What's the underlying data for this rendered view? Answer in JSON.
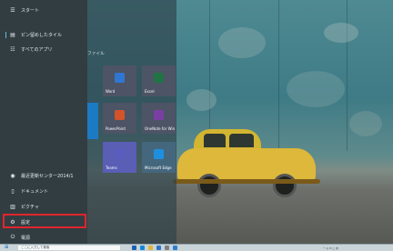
{
  "start_menu": {
    "nav": [
      {
        "icon": "hamburger-icon",
        "glyph": "☰",
        "label": "スタート"
      },
      {
        "icon": "pin-icon",
        "glyph": "▤",
        "label": "ピン留めしたタイル"
      },
      {
        "icon": "list-icon",
        "glyph": "☷",
        "label": "すべてのアプリ"
      }
    ],
    "bottom_nav": [
      {
        "icon": "security-icon",
        "glyph": "◉",
        "label": "最近更新センター2014/1"
      },
      {
        "icon": "document-icon",
        "glyph": "▯",
        "label": "ドキュメント"
      },
      {
        "icon": "picture-icon",
        "glyph": "▥",
        "label": "ピクチャ"
      },
      {
        "icon": "gear-icon",
        "glyph": "⚙",
        "label": "設定"
      },
      {
        "icon": "power-icon",
        "glyph": "⏻",
        "label": "電源"
      }
    ],
    "section_title": "ファイル",
    "tiles": [
      {
        "name": "Word",
        "color": "#2f77d3"
      },
      {
        "name": "Excel",
        "color": "#217346"
      },
      {
        "name": "PowerPoint",
        "color": "#d35428"
      },
      {
        "name": "OneNote for Windows",
        "color": "#7b3fa4"
      },
      {
        "name": "Teams",
        "color": "#5a5dbd"
      },
      {
        "name": "Microsoft Edge",
        "color": "#1e8fe0"
      }
    ]
  },
  "taskbar": {
    "search_placeholder": "ここに入力して検索",
    "apps": [
      {
        "icon": "task-view-icon",
        "color": "#1b5fb2"
      },
      {
        "icon": "edge-icon",
        "color": "#1587d6"
      },
      {
        "icon": "folder-icon",
        "color": "#e0b43d"
      },
      {
        "icon": "store-icon",
        "color": "#2f74c5"
      },
      {
        "icon": "settings-icon",
        "color": "#7b7f83"
      },
      {
        "icon": "mail-icon",
        "color": "#2a7ed0"
      }
    ],
    "tray_text": "^  ◎  ✉  ◻  あ",
    "time": "",
    "accent": "#0078d4"
  },
  "highlight_color": "#e0252c"
}
